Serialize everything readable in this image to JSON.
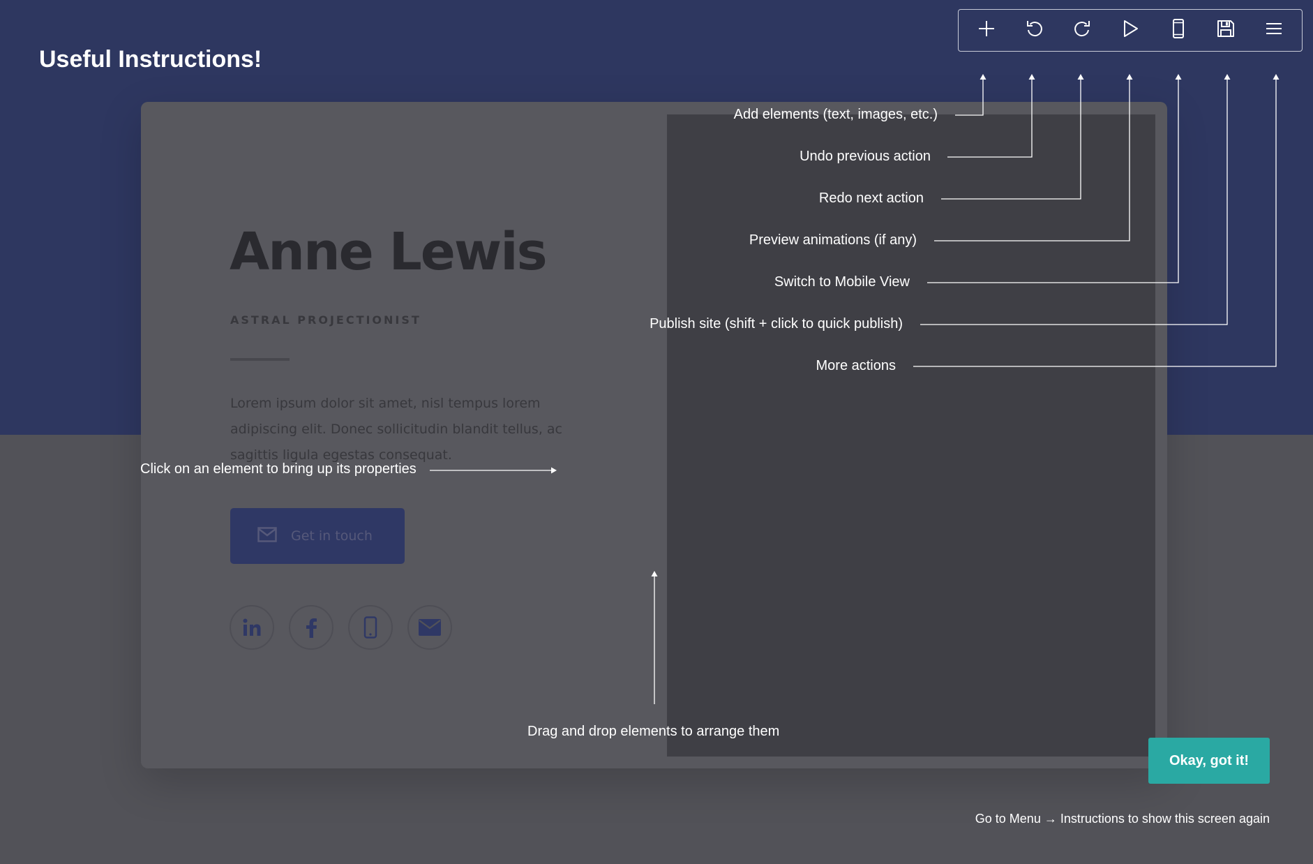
{
  "overlay": {
    "title": "Useful Instructions!",
    "toolbar": [
      {
        "icon": "plus-icon",
        "hint": "Add elements (text, images, etc.)"
      },
      {
        "icon": "undo-icon",
        "hint": "Undo previous action"
      },
      {
        "icon": "redo-icon",
        "hint": "Redo next action"
      },
      {
        "icon": "play-icon",
        "hint": "Preview animations (if any)"
      },
      {
        "icon": "mobile-icon",
        "hint": "Switch to Mobile View"
      },
      {
        "icon": "save-icon",
        "hint": "Publish site (shift + click to quick publish)"
      },
      {
        "icon": "menu-icon",
        "hint": "More actions"
      }
    ],
    "click_hint": "Click on an element to bring up its properties",
    "drag_hint": "Drag and drop elements to arrange them",
    "ok_label": "Okay, got it!",
    "footer_note": "Go to Menu → Instructions to show this screen again"
  },
  "profile": {
    "name": "Anne Lewis",
    "role": "ASTRAL PROJECTIONIST",
    "bio": "Lorem ipsum dolor sit amet, nisl tempus lorem adipiscing elit. Donec sollicitudin blandit tellus, ac sagittis ligula egestas consequat.",
    "cta_label": "Get in touch",
    "socials": [
      "linkedin-icon",
      "facebook-icon",
      "phone-icon",
      "email-icon"
    ]
  },
  "colors": {
    "header_bg": "#2e3760",
    "page_bg": "#525258",
    "accent": "#2aa9a3",
    "button_bg": "#2f3865"
  }
}
